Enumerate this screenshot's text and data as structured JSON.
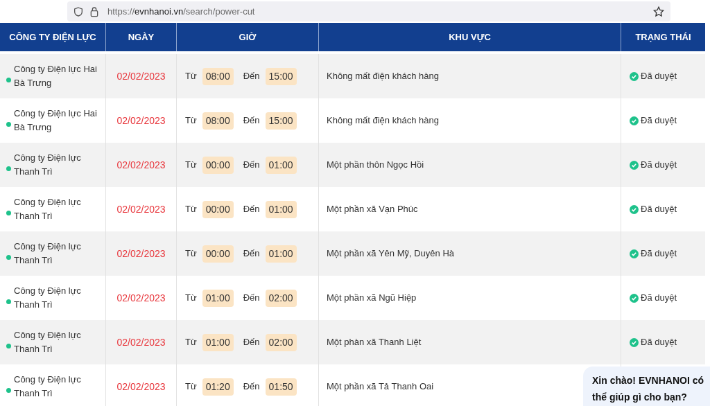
{
  "browser": {
    "url": "https://evnhanoi.vn/search/power-cut"
  },
  "table": {
    "columns": [
      "CÔNG TY ĐIỆN LỰC",
      "NGÀY",
      "GIỜ",
      "KHU VỰC",
      "TRẠNG THÁI"
    ],
    "rows": [
      {
        "company": "Công ty Điện lực Hai Bà Trưng",
        "date": "02/02/2023",
        "from_label": "Từ",
        "from": "08:00",
        "to_label": "Đến",
        "to": "15:00",
        "area": "Không mất điện khách hàng",
        "status": "Đã duyệt"
      },
      {
        "company": "Công ty Điện lực Hai Bà Trưng",
        "date": "02/02/2023",
        "from_label": "Từ",
        "from": "08:00",
        "to_label": "Đến",
        "to": "15:00",
        "area": "Không mất điện khách hàng",
        "status": "Đã duyệt"
      },
      {
        "company": "Công ty Điện lực Thanh Trì",
        "date": "02/02/2023",
        "from_label": "Từ",
        "from": "00:00",
        "to_label": "Đến",
        "to": "01:00",
        "area": "Một phần thôn Ngọc Hồi",
        "status": "Đã duyệt"
      },
      {
        "company": "Công ty Điện lực Thanh Trì",
        "date": "02/02/2023",
        "from_label": "Từ",
        "from": "00:00",
        "to_label": "Đến",
        "to": "01:00",
        "area": "Một phần xã Vạn Phúc",
        "status": "Đã duyệt"
      },
      {
        "company": "Công ty Điện lực Thanh Trì",
        "date": "02/02/2023",
        "from_label": "Từ",
        "from": "00:00",
        "to_label": "Đến",
        "to": "01:00",
        "area": "Một phần xã Yên Mỹ, Duyên Hà",
        "status": "Đã duyệt"
      },
      {
        "company": "Công ty Điện lực Thanh Trì",
        "date": "02/02/2023",
        "from_label": "Từ",
        "from": "01:00",
        "to_label": "Đến",
        "to": "02:00",
        "area": "Một phần xã Ngũ Hiệp",
        "status": "Đã duyệt"
      },
      {
        "company": "Công ty Điện lực Thanh Trì",
        "date": "02/02/2023",
        "from_label": "Từ",
        "from": "01:00",
        "to_label": "Đến",
        "to": "02:00",
        "area": "Một phàn xã Thanh Liệt",
        "status": "Đã duyệt"
      },
      {
        "company": "Công ty Điện lực Thanh Trì",
        "date": "02/02/2023",
        "from_label": "Từ",
        "from": "01:20",
        "to_label": "Đến",
        "to": "01:50",
        "area": "Một phần xã Tả Thanh Oai"
      }
    ]
  },
  "chat": {
    "message": "Xin chào! EVNHANOI có thể giúp gì cho bạn?"
  }
}
